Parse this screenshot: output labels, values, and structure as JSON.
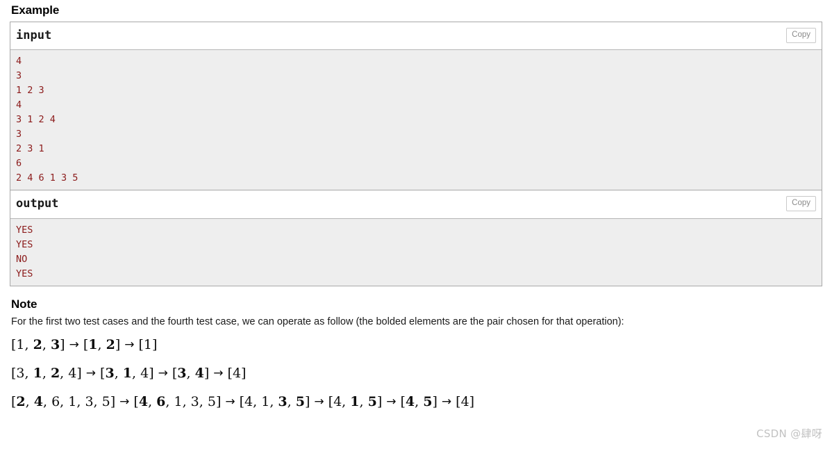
{
  "example": {
    "heading": "Example",
    "blocks": [
      {
        "title": "input",
        "copy_label": "Copy",
        "lines": [
          "4",
          "3",
          "1 2 3",
          "4",
          "3 1 2 4",
          "3",
          "2 3 1",
          "6",
          "2 4 6 1 3 5"
        ]
      },
      {
        "title": "output",
        "copy_label": "Copy",
        "lines": [
          "YES",
          "YES",
          "NO",
          "YES"
        ]
      }
    ]
  },
  "note": {
    "heading": "Note",
    "text": "For the first two test cases and the fourth test case, we can operate as follow (the bolded elements are the pair chosen for that operation):",
    "formulas": [
      {
        "steps": [
          {
            "open": "[",
            "items": [
              {
                "t": "1",
                "b": false
              },
              {
                "t": "2",
                "b": true
              },
              {
                "t": "3",
                "b": true
              }
            ],
            "close": "]"
          },
          {
            "open": "[",
            "items": [
              {
                "t": "1",
                "b": true
              },
              {
                "t": "2",
                "b": true
              }
            ],
            "close": "]"
          },
          {
            "open": "[",
            "items": [
              {
                "t": "1",
                "b": false
              }
            ],
            "close": "]"
          }
        ]
      },
      {
        "steps": [
          {
            "open": "[",
            "items": [
              {
                "t": "3",
                "b": false
              },
              {
                "t": "1",
                "b": true
              },
              {
                "t": "2",
                "b": true
              },
              {
                "t": "4",
                "b": false
              }
            ],
            "close": "]"
          },
          {
            "open": "[",
            "items": [
              {
                "t": "3",
                "b": true
              },
              {
                "t": "1",
                "b": true
              },
              {
                "t": "4",
                "b": false
              }
            ],
            "close": "]"
          },
          {
            "open": "[",
            "items": [
              {
                "t": "3",
                "b": true
              },
              {
                "t": "4",
                "b": true
              }
            ],
            "close": "]"
          },
          {
            "open": "[",
            "items": [
              {
                "t": "4",
                "b": false
              }
            ],
            "close": "]"
          }
        ]
      },
      {
        "steps": [
          {
            "open": "[",
            "items": [
              {
                "t": "2",
                "b": true
              },
              {
                "t": "4",
                "b": true
              },
              {
                "t": "6",
                "b": false
              },
              {
                "t": "1",
                "b": false
              },
              {
                "t": "3",
                "b": false
              },
              {
                "t": "5",
                "b": false
              }
            ],
            "close": "]"
          },
          {
            "open": "[",
            "items": [
              {
                "t": "4",
                "b": true
              },
              {
                "t": "6",
                "b": true
              },
              {
                "t": "1",
                "b": false
              },
              {
                "t": "3",
                "b": false
              },
              {
                "t": "5",
                "b": false
              }
            ],
            "close": "]"
          },
          {
            "open": "[",
            "items": [
              {
                "t": "4",
                "b": false
              },
              {
                "t": "1",
                "b": false
              },
              {
                "t": "3",
                "b": true
              },
              {
                "t": "5",
                "b": true
              }
            ],
            "close": "]"
          },
          {
            "open": "[",
            "items": [
              {
                "t": "4",
                "b": false
              },
              {
                "t": "1",
                "b": true
              },
              {
                "t": "5",
                "b": true
              }
            ],
            "close": "]"
          },
          {
            "open": "[",
            "items": [
              {
                "t": "4",
                "b": true
              },
              {
                "t": "5",
                "b": true
              }
            ],
            "close": "]"
          },
          {
            "open": "[",
            "items": [
              {
                "t": "4",
                "b": false
              }
            ],
            "close": "]"
          }
        ]
      }
    ],
    "arrow_glyph": "→"
  },
  "watermark": {
    "text": "CSDN @肆呀"
  }
}
